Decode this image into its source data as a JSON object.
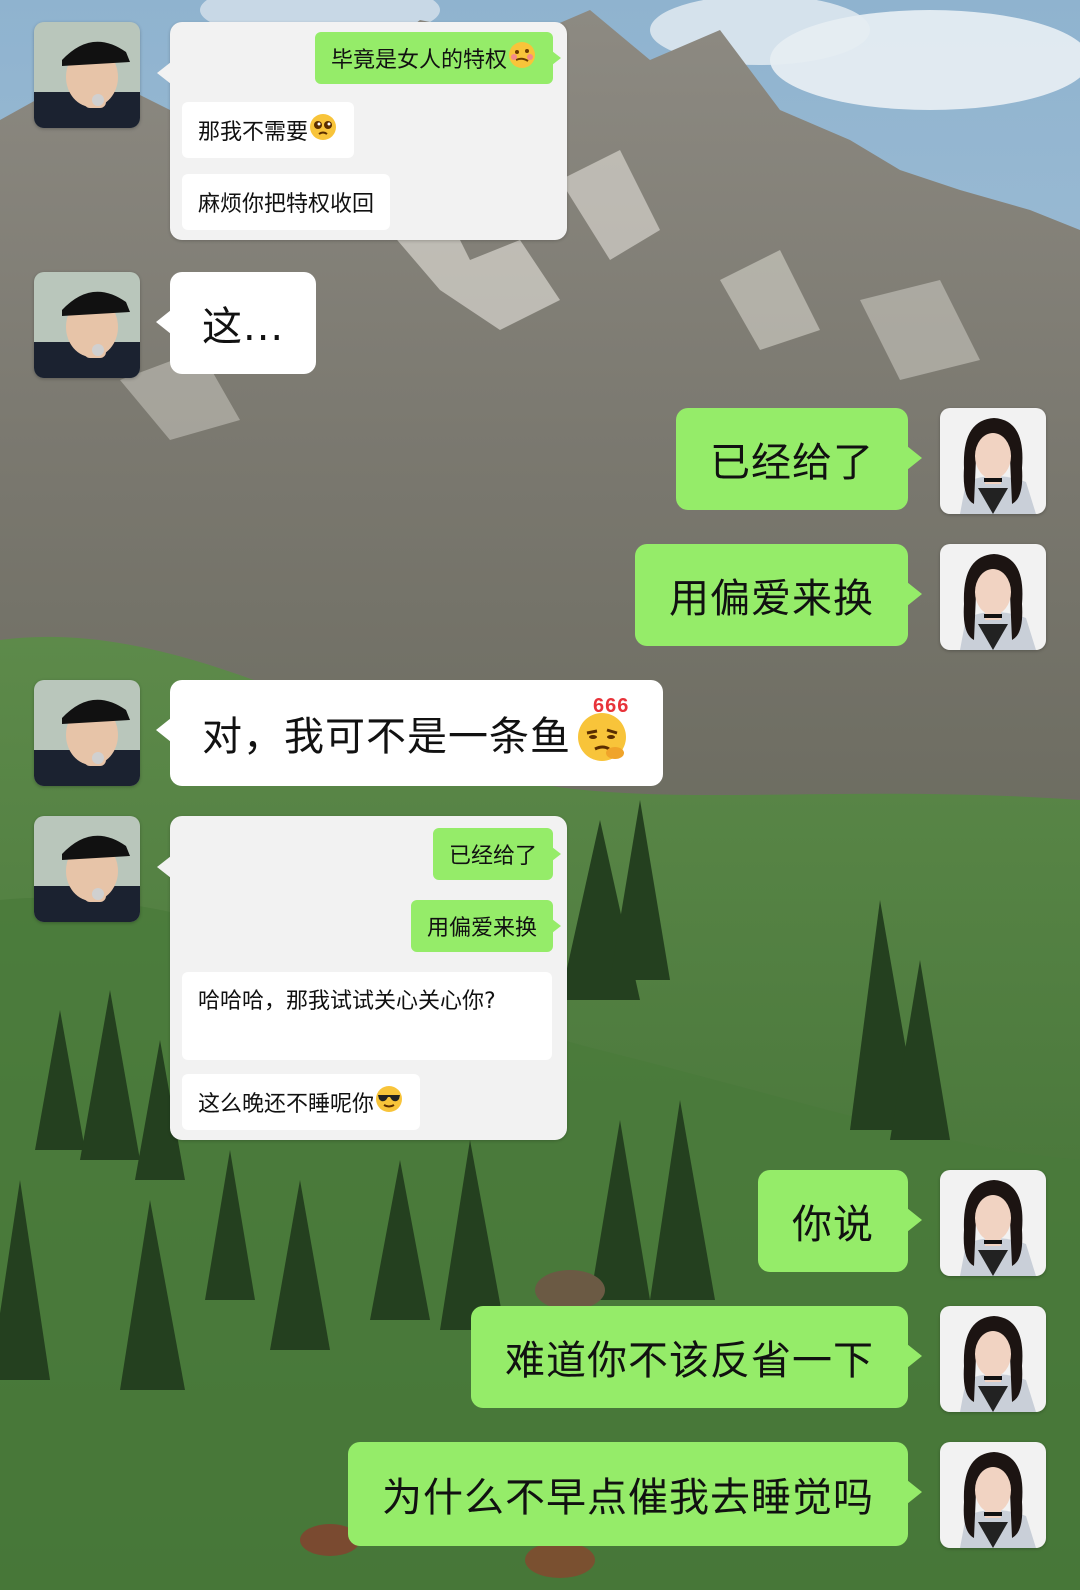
{
  "embedded_screenshots": [
    {
      "messages": [
        {
          "side": "right",
          "text": "毕竟是女人的特权",
          "emoji": "woozy-face-icon"
        },
        {
          "side": "left",
          "text": "那我不需要",
          "emoji": "pleading-face-icon"
        },
        {
          "side": "left",
          "text": "麻烦你把特权收回"
        }
      ]
    },
    {
      "messages": [
        {
          "side": "right",
          "text": "已经给了"
        },
        {
          "side": "right",
          "text": "用偏爱来换"
        },
        {
          "side": "left",
          "text": "哈哈哈，那我试试关心关心你?"
        },
        {
          "side": "left",
          "text": "这么晚还不睡呢你",
          "emoji": "sunglasses-face-icon"
        }
      ]
    }
  ],
  "messages": [
    {
      "side": "left",
      "text": "这..."
    },
    {
      "side": "right",
      "text": "已经给了"
    },
    {
      "side": "right",
      "text": "用偏爱来换"
    },
    {
      "side": "left",
      "text": "对，我可不是一条鱼",
      "emoji": "thinking-666-icon",
      "emoji_badge": "666"
    },
    {
      "side": "right",
      "text": "你说"
    },
    {
      "side": "right",
      "text": "难道你不该反省一下"
    },
    {
      "side": "right",
      "text": "为什么不早点催我去睡觉吗"
    }
  ],
  "colors": {
    "outgoing_bubble": "#95ec69",
    "incoming_bubble": "#ffffff",
    "quoted_card": "#f2f2f2"
  }
}
